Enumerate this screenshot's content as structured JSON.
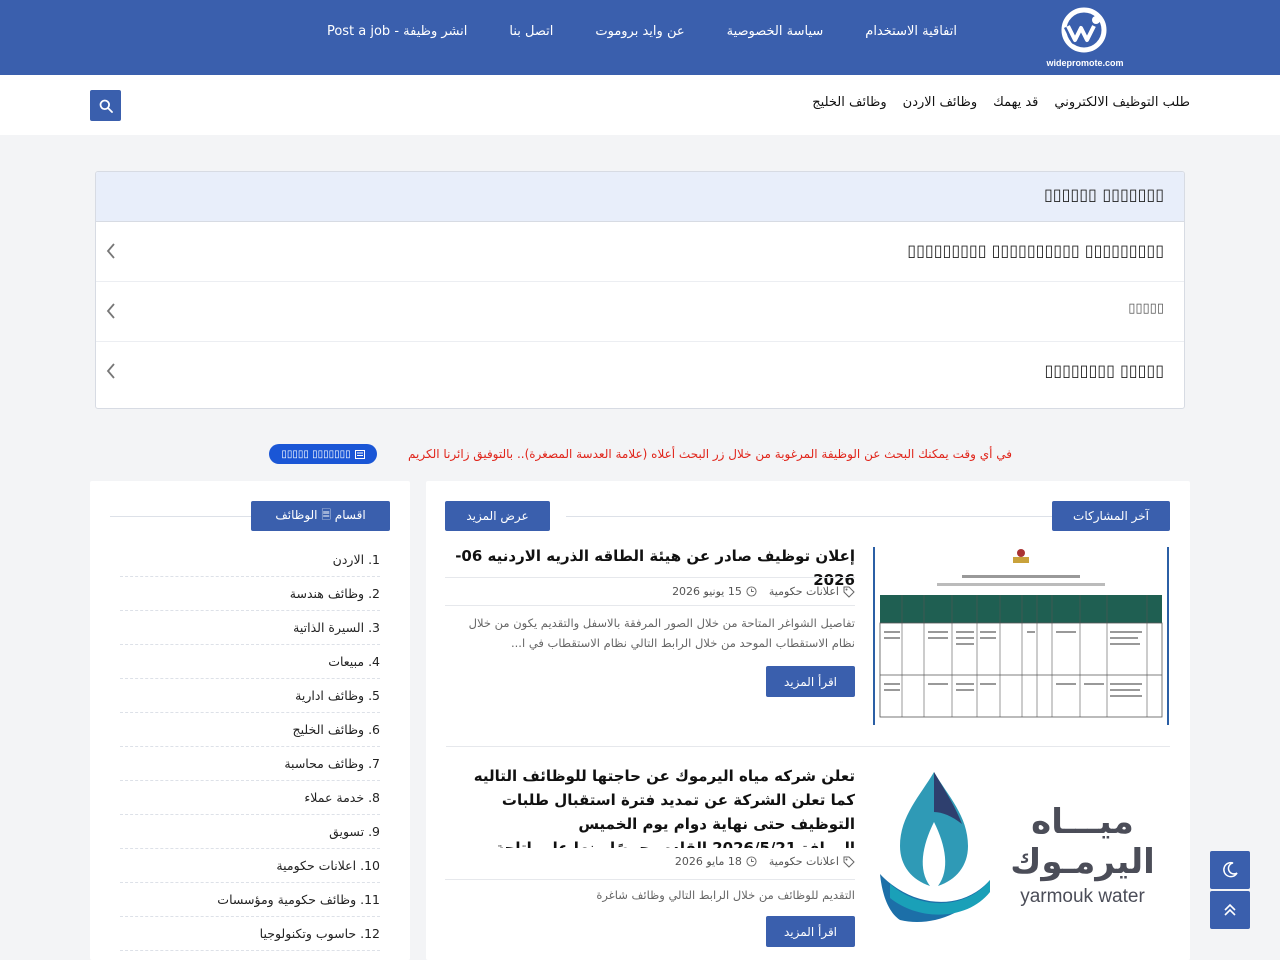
{
  "header": {
    "logo_text": "widepromote.com",
    "nav": [
      "اتفاقية الاستخدام",
      "سياسة الخصوصية",
      "عن وايد بروموت",
      "اتصل بنا",
      "انشر وظيفة - Post a job"
    ]
  },
  "subnav": {
    "items": [
      "طلب التوظيف الالكتروني",
      "قد يهمك",
      "وظائف الاردن",
      "وظائف الخليج"
    ]
  },
  "accordion": {
    "title": "▯▯▯▯▯▯▯ ▯▯▯▯▯▯",
    "rows": [
      "▯▯▯▯▯▯▯▯▯ ▯▯▯▯▯▯▯▯▯▯ ▯▯▯▯▯▯▯▯▯",
      "▯▯▯▯▯",
      "▯▯▯▯▯ ▯▯▯▯▯▯▯▯"
    ]
  },
  "notice": {
    "text": "في أي وقت يمكنك البحث عن الوظيفة المرغوبة من خلال زر البحث أعلاه (علامة العدسة المصغرة).. بالتوفيق زائرنا الكريم",
    "button_label": "▯▯▯▯▯▯▯ ▯▯▯▯▯"
  },
  "main": {
    "section_title": "آخر المشاركات",
    "more_label": "عرض المزيد",
    "posts": [
      {
        "title": "إعلان توظيف صادر عن هيئة الطاقه الذريه الاردنيه 06-2026",
        "category": "اعلانات حكومية",
        "date": "15 يونيو 2026",
        "excerpt": "تفاصيل الشواغر المتاحة من خلال الصور المرفقة بالاسفل والتقديم يكون من خلال نظام الاستقطاب الموحد من خلال الرابط التالي نظام الاستقطاب في ا...",
        "read_more": "اقرأ المزيد"
      },
      {
        "title": "تعلن شركه مياه اليرموك عن حاجتها للوظائف التاليه كما تعلن الشركة عن تمديد فترة استقبال طلبات التوظيف حتى نهاية دوام يوم الخميس الموافق2026/5/21 القادم، حرصًا منها على اتاحة الفرصة الكافية أمام الجميع لاستكمال اجراءات التقديم",
        "category": "اعلانات حكومية",
        "date": "18 مايو 2026",
        "excerpt": "التقديم للوظائف من خلال الرابط التالي وظائف شاغرة",
        "read_more": "اقرأ المزيد",
        "logo_ar": "ميـــاه اليرمـوك",
        "logo_en": "yarmouk water"
      }
    ]
  },
  "sidebar": {
    "title": "اقسام 🗏 الوظائف",
    "categories": [
      {
        "num": "1.",
        "label": "الاردن"
      },
      {
        "num": "2.",
        "label": "وظائف هندسة"
      },
      {
        "num": "3.",
        "label": "السيرة الذاتية"
      },
      {
        "num": "4.",
        "label": "مبيعات"
      },
      {
        "num": "5.",
        "label": "وظائف ادارية"
      },
      {
        "num": "6.",
        "label": "وظائف الخليج"
      },
      {
        "num": "7.",
        "label": "وظائف محاسبة"
      },
      {
        "num": "8.",
        "label": "خدمة عملاء"
      },
      {
        "num": "9.",
        "label": "تسويق"
      },
      {
        "num": "10.",
        "label": "اعلانات حكومية"
      },
      {
        "num": "11.",
        "label": "وظائف حكومية ومؤسسات"
      },
      {
        "num": "12.",
        "label": "حاسوب وتكنولوجيا"
      }
    ]
  },
  "colors": {
    "brand": "#3a5fad",
    "notice": "#e0251b",
    "notice_button": "#1a56d6"
  },
  "icons": [
    "search-icon",
    "chevron-left-icon",
    "tag-icon",
    "clock-icon",
    "moon-icon",
    "double-chevron-up-icon"
  ]
}
